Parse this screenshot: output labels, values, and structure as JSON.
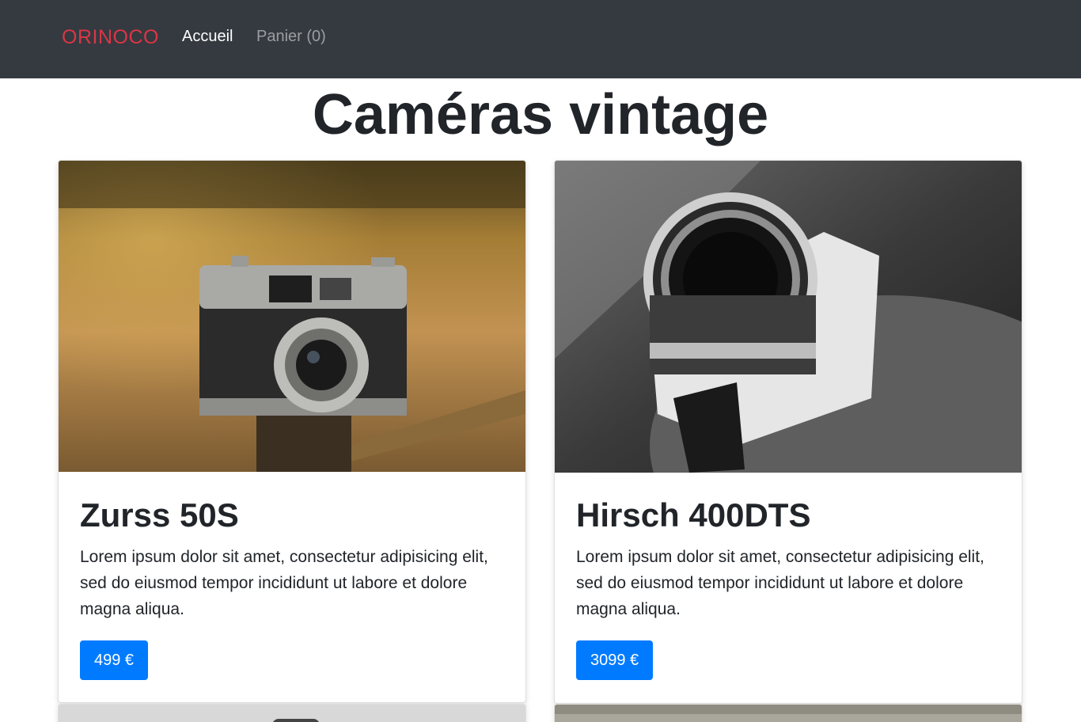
{
  "navbar": {
    "brand": "ORINOCO",
    "links": [
      {
        "label": "Accueil"
      },
      {
        "label": "Panier (0)"
      }
    ]
  },
  "page": {
    "title": "Caméras vintage"
  },
  "products": [
    {
      "name": "Zurss 50S",
      "description": "Lorem ipsum dolor sit amet, consectetur adipisicing elit, sed do eiusmod tempor incididunt ut labore et dolore magna aliqua.",
      "price": "499 €"
    },
    {
      "name": "Hirsch 400DTS",
      "description": "Lorem ipsum dolor sit amet, consectetur adipisicing elit, sed do eiusmod tempor incididunt ut labore et dolore magna aliqua.",
      "price": "3099 €"
    }
  ],
  "colors": {
    "navbar_bg": "#343a40",
    "brand": "#dc3545",
    "button": "#007bff"
  }
}
